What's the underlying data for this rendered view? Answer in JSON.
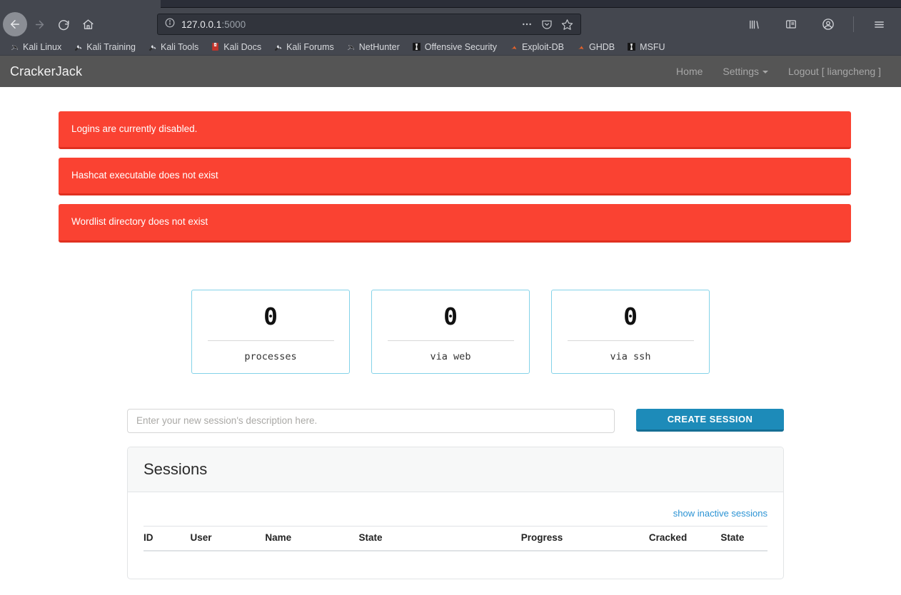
{
  "browser": {
    "url_host": "127.0.0.1",
    "url_port": ":5000",
    "back_icon": "back-arrow-icon",
    "forward_icon": "forward-arrow-icon",
    "reload_icon": "reload-icon",
    "home_icon": "home-icon",
    "info_icon": "page-info-icon",
    "more_icon": "more-options-icon",
    "pocket_icon": "pocket-icon",
    "bookmark_icon": "star-icon",
    "library_icon": "library-icon",
    "sidebar_icon": "sidebar-icon",
    "account_icon": "account-icon",
    "menu_icon": "hamburger-menu-icon",
    "bookmarks": [
      {
        "label": "Kali Linux",
        "icon": "kali-dragon-icon"
      },
      {
        "label": "Kali Training",
        "icon": "wrench-icon"
      },
      {
        "label": "Kali Tools",
        "icon": "wrench-icon"
      },
      {
        "label": "Kali Docs",
        "icon": "book-icon"
      },
      {
        "label": "Kali Forums",
        "icon": "wrench-icon"
      },
      {
        "label": "NetHunter",
        "icon": "kali-dragon-icon"
      },
      {
        "label": "Offensive Security",
        "icon": "offsec-icon"
      },
      {
        "label": "Exploit-DB",
        "icon": "flame-icon"
      },
      {
        "label": "GHDB",
        "icon": "flame-icon"
      },
      {
        "label": "MSFU",
        "icon": "offsec-icon"
      }
    ]
  },
  "appbar": {
    "brand": "CrackerJack",
    "home_label": "Home",
    "settings_label": "Settings",
    "logout_label": "Logout [ liangcheng ]"
  },
  "alerts": [
    {
      "message": "Logins are currently disabled."
    },
    {
      "message": "Hashcat executable does not exist"
    },
    {
      "message": "Wordlist directory does not exist"
    }
  ],
  "stats": [
    {
      "value": "0",
      "label": "processes"
    },
    {
      "value": "0",
      "label": "via web"
    },
    {
      "value": "0",
      "label": "via ssh"
    }
  ],
  "create_session": {
    "input_value": "",
    "input_placeholder": "Enter your new session's description here.",
    "button_label": "CREATE SESSION"
  },
  "sessions_panel": {
    "title": "Sessions",
    "show_inactive_label": "show inactive sessions",
    "columns": [
      "ID",
      "User",
      "Name",
      "State",
      "Progress",
      "Cracked",
      "State"
    ],
    "rows": []
  },
  "colors": {
    "alert_red": "#fa4232",
    "accent_blue": "#1d8bb9",
    "link_blue": "#2b93d4",
    "card_border": "#84d2e8",
    "navbar_gray": "#555555",
    "chrome_gray": "#44474f"
  }
}
